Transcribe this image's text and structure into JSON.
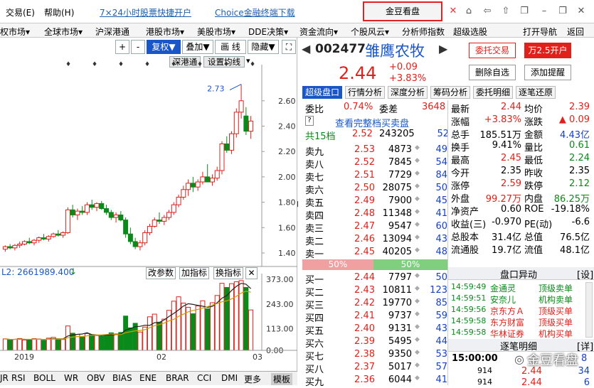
{
  "menubar": {
    "trade": "交易(E)",
    "help": "帮助(H)",
    "link1": "7×24小时股票快捷开户",
    "link2": "Choice金融终端下载",
    "promo": "金豆看盘"
  },
  "nav": [
    "权市场▾",
    "全球市场▾",
    "沪深港通",
    "港股市场▾",
    "美股市场▾",
    "DDE决策▾",
    "资金流向▾",
    "个股风云▾",
    "分析师指数",
    "超级选股",
    "打开导航",
    "返回"
  ],
  "toolbar": {
    "plus": "+",
    "minus": "-",
    "fuquan": "复权▼",
    "diejia": "叠加▼",
    "huaxian": "画 线",
    "yincang": "隐藏▼",
    "expand": "⛶"
  },
  "chart_tabs": {
    "shentong": "深港通",
    "shezhi": "设置均线"
  },
  "kline": {
    "price_axis": [
      "2.60",
      "2.40",
      "2.20",
      "2.00",
      "1.80",
      "1.60",
      "1.40"
    ],
    "high_label": "2.73",
    "x_labels": [
      "2019",
      "02",
      "03"
    ],
    "candles": [
      {
        "o": 1.43,
        "h": 1.46,
        "l": 1.41,
        "c": 1.45
      },
      {
        "o": 1.45,
        "h": 1.47,
        "l": 1.43,
        "c": 1.44
      },
      {
        "o": 1.44,
        "h": 1.47,
        "l": 1.42,
        "c": 1.46
      },
      {
        "o": 1.46,
        "h": 1.49,
        "l": 1.44,
        "c": 1.47
      },
      {
        "o": 1.47,
        "h": 1.5,
        "l": 1.46,
        "c": 1.49
      },
      {
        "o": 1.49,
        "h": 1.52,
        "l": 1.47,
        "c": 1.48
      },
      {
        "o": 1.48,
        "h": 1.51,
        "l": 1.46,
        "c": 1.5
      },
      {
        "o": 1.5,
        "h": 1.53,
        "l": 1.48,
        "c": 1.52
      },
      {
        "o": 1.52,
        "h": 1.55,
        "l": 1.5,
        "c": 1.51
      },
      {
        "o": 1.51,
        "h": 1.54,
        "l": 1.49,
        "c": 1.53
      },
      {
        "o": 1.53,
        "h": 1.56,
        "l": 1.52,
        "c": 1.55
      },
      {
        "o": 1.55,
        "h": 1.58,
        "l": 1.53,
        "c": 1.54
      },
      {
        "o": 1.54,
        "h": 1.57,
        "l": 1.52,
        "c": 1.56
      },
      {
        "o": 1.56,
        "h": 1.76,
        "l": 1.55,
        "c": 1.74
      },
      {
        "o": 1.74,
        "h": 1.78,
        "l": 1.68,
        "c": 1.7
      },
      {
        "o": 1.7,
        "h": 1.75,
        "l": 1.66,
        "c": 1.73
      },
      {
        "o": 1.73,
        "h": 1.77,
        "l": 1.7,
        "c": 1.72
      },
      {
        "o": 1.72,
        "h": 1.8,
        "l": 1.7,
        "c": 1.78
      },
      {
        "o": 1.78,
        "h": 1.82,
        "l": 1.74,
        "c": 1.76
      },
      {
        "o": 1.76,
        "h": 1.8,
        "l": 1.73,
        "c": 1.79
      },
      {
        "o": 1.79,
        "h": 1.81,
        "l": 1.74,
        "c": 1.75
      },
      {
        "o": 1.75,
        "h": 1.78,
        "l": 1.7,
        "c": 1.72
      },
      {
        "o": 1.72,
        "h": 1.74,
        "l": 1.66,
        "c": 1.68
      },
      {
        "o": 1.68,
        "h": 1.72,
        "l": 1.64,
        "c": 1.7
      },
      {
        "o": 1.7,
        "h": 1.73,
        "l": 1.65,
        "c": 1.66
      },
      {
        "o": 1.66,
        "h": 1.68,
        "l": 1.52,
        "c": 1.55
      },
      {
        "o": 1.55,
        "h": 1.6,
        "l": 1.47,
        "c": 1.49
      },
      {
        "o": 1.49,
        "h": 1.52,
        "l": 1.43,
        "c": 1.45
      },
      {
        "o": 1.45,
        "h": 1.5,
        "l": 1.42,
        "c": 1.48
      },
      {
        "o": 1.48,
        "h": 1.58,
        "l": 1.46,
        "c": 1.56
      },
      {
        "o": 1.56,
        "h": 1.63,
        "l": 1.54,
        "c": 1.61
      },
      {
        "o": 1.61,
        "h": 1.68,
        "l": 1.6,
        "c": 1.66
      },
      {
        "o": 1.66,
        "h": 1.72,
        "l": 1.63,
        "c": 1.65
      },
      {
        "o": 1.65,
        "h": 1.7,
        "l": 1.62,
        "c": 1.68
      },
      {
        "o": 1.68,
        "h": 1.74,
        "l": 1.66,
        "c": 1.72
      },
      {
        "o": 1.72,
        "h": 1.8,
        "l": 1.7,
        "c": 1.78
      },
      {
        "o": 1.78,
        "h": 1.86,
        "l": 1.76,
        "c": 1.84
      },
      {
        "o": 1.84,
        "h": 1.93,
        "l": 1.82,
        "c": 1.9
      },
      {
        "o": 1.9,
        "h": 1.98,
        "l": 1.85,
        "c": 1.95
      },
      {
        "o": 1.95,
        "h": 2.0,
        "l": 1.88,
        "c": 1.92
      },
      {
        "o": 1.92,
        "h": 1.98,
        "l": 1.89,
        "c": 1.96
      },
      {
        "o": 1.96,
        "h": 2.04,
        "l": 1.94,
        "c": 2.0
      },
      {
        "o": 2.0,
        "h": 2.1,
        "l": 1.98,
        "c": 1.96
      },
      {
        "o": 1.96,
        "h": 2.02,
        "l": 1.93,
        "c": 1.99
      },
      {
        "o": 1.99,
        "h": 2.08,
        "l": 1.97,
        "c": 2.05
      },
      {
        "o": 2.05,
        "h": 2.28,
        "l": 2.02,
        "c": 2.26
      },
      {
        "o": 2.26,
        "h": 2.32,
        "l": 2.19,
        "c": 2.21
      },
      {
        "o": 2.21,
        "h": 2.36,
        "l": 2.18,
        "c": 2.34
      },
      {
        "o": 2.34,
        "h": 2.54,
        "l": 2.31,
        "c": 2.51
      },
      {
        "o": 2.51,
        "h": 2.73,
        "l": 2.46,
        "c": 2.6
      },
      {
        "o": 2.48,
        "h": 2.55,
        "l": 2.33,
        "c": 2.36
      },
      {
        "o": 2.36,
        "h": 2.48,
        "l": 2.3,
        "c": 2.44
      }
    ]
  },
  "indicator_label": "L2: 2661989.400",
  "indicator_btns": [
    "改参数",
    "加指标",
    "换指标"
  ],
  "vol_axis": [
    "373.00",
    "243.00",
    "113.00",
    "0.00"
  ],
  "volumes": [
    60,
    55,
    58,
    62,
    54,
    57,
    61,
    59,
    52,
    64,
    68,
    60,
    57,
    128,
    90,
    84,
    70,
    88,
    82,
    78,
    74,
    80,
    92,
    86,
    94,
    180,
    118,
    142,
    96,
    122,
    176,
    190,
    148,
    164,
    210,
    258,
    281,
    248,
    226,
    192,
    233,
    260,
    218,
    250,
    288,
    352,
    330,
    350,
    360,
    366,
    330,
    212
  ],
  "bottom_tabs": [
    "JR",
    "RSI",
    "BOLL",
    "WR",
    "OBV",
    "BIAS",
    "ENE",
    "BRAR",
    "CCI",
    "DMI",
    "更多",
    "模板"
  ],
  "stock": {
    "code": "002477",
    "name": "雏鹰农牧",
    "price": "2.44",
    "change": "+0.09",
    "pct": "+3.83%",
    "btn_trust": "委托交易",
    "btn_open": "万2.5开户",
    "btn_del": "删除自选",
    "btn_alert": "添加提醒"
  },
  "tabs": [
    "超级盘口",
    "行情分析",
    "深度分析",
    "筹码分析",
    "委托明细",
    "逐笔还原"
  ],
  "weibi": {
    "label1": "委比",
    "v1": "0.74%",
    "label2": "委差",
    "v2": "3648",
    "full": "查看完整档买卖盘",
    "q": "?"
  },
  "total_level": {
    "label": "共15档",
    "price": "2.52",
    "vol": "243205",
    "count": "52"
  },
  "asks": [
    [
      "卖九",
      "2.53",
      "4873",
      "49"
    ],
    [
      "卖八",
      "2.52",
      "7845",
      "54"
    ],
    [
      "卖七",
      "2.51",
      "7729",
      "84"
    ],
    [
      "卖六",
      "2.50",
      "28075",
      "50"
    ],
    [
      "卖五",
      "2.49",
      "7900",
      "45"
    ],
    [
      "卖四",
      "2.48",
      "11348",
      "41"
    ],
    [
      "卖三",
      "2.47",
      "9547",
      "60"
    ],
    [
      "卖二",
      "2.46",
      "13094",
      "43"
    ],
    [
      "卖一",
      "2.45",
      "40205",
      "48"
    ]
  ],
  "ratio_bar": {
    "left": "50%",
    "right": "50%"
  },
  "bids": [
    [
      "买一",
      "2.44",
      "7797",
      "50"
    ],
    [
      "买二",
      "2.43",
      "10811",
      "123"
    ],
    [
      "买三",
      "2.42",
      "19770",
      "85"
    ],
    [
      "买四",
      "2.41",
      "9737",
      "59"
    ],
    [
      "买五",
      "2.40",
      "9131",
      "43"
    ],
    [
      "买六",
      "2.39",
      "5495",
      "44"
    ],
    [
      "买七",
      "2.38",
      "9350",
      "53"
    ],
    [
      "买八",
      "2.37",
      "5017",
      "57"
    ],
    [
      "买九",
      "2.36",
      "6044",
      "41"
    ]
  ],
  "stats": [
    [
      "最新",
      "2.44",
      "均价",
      "2.39"
    ],
    [
      "涨幅",
      "+3.83%",
      "涨跌",
      "▲ 0.09"
    ],
    [
      "总手",
      "185.51万",
      "金额",
      "4.43亿"
    ],
    [
      "换手",
      "9.41%",
      "量比",
      "0.61"
    ],
    [
      "最高",
      "2.45",
      "最低",
      "2.24"
    ],
    [
      "今开",
      "2.35",
      "昨收",
      "2.35"
    ],
    [
      "涨停",
      "2.59",
      "跌停",
      "2.12"
    ],
    [
      "外盘",
      "99.27万",
      "内盘",
      "86.25万"
    ],
    [
      "净资产",
      "0.60",
      "ROE",
      "-19.18%"
    ],
    [
      "收益(三)",
      "-0.970",
      "PE(动)",
      "-6.6"
    ],
    [
      "总股本",
      "31.4亿",
      "总值",
      "76.5亿"
    ],
    [
      "流通股",
      "19.7亿",
      "流值",
      "48.1亿"
    ]
  ],
  "pankou": {
    "title": "盘口异动",
    "set": "[设]",
    "rows": [
      [
        "14:59:49",
        "金通灵",
        "顶级卖单"
      ],
      [
        "14:59:51",
        "安奈儿",
        "机构卖单"
      ],
      [
        "14:59:56",
        "京东方Ａ",
        "顶级买单"
      ],
      [
        "14:59:58",
        "东方财富",
        "顶级买单"
      ],
      [
        "14:59:58",
        "华林证券",
        "机构买单"
      ]
    ]
  },
  "zhubi": {
    "title": "逐笔明细",
    "btn": "[详]",
    "time": "15:00:00",
    "val1": "8",
    "rows": [
      [
        "914",
        "2.44",
        "34"
      ],
      [
        "914",
        "2.44",
        "6"
      ]
    ]
  },
  "watermark": "金豆看盘"
}
